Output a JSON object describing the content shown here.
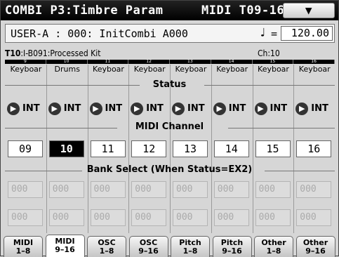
{
  "title": {
    "mode": "COMBI",
    "page": "P3:Timbre Param",
    "subpage": "MIDI T09-16",
    "menu_symbol": "▼"
  },
  "program": {
    "name": "USER-A : 000: InitCombi  A000",
    "tempo_symbol": "♩",
    "tempo_eq": "=",
    "tempo": "120.00"
  },
  "info": {
    "timbre_prefix": "T10",
    "timbre_name": ":I-B091:Processed Kit",
    "channel": "Ch:10"
  },
  "columns": [
    "9",
    "10",
    "11",
    "12",
    "13",
    "14",
    "15",
    "16"
  ],
  "types": [
    "Keyboar",
    "Drums",
    "Keyboar",
    "Keyboar",
    "Keyboar",
    "Keyboar",
    "Keyboar",
    "Keyboar"
  ],
  "labels": {
    "status": "Status",
    "midi_channel": "MIDI Channel",
    "bank_select": "Bank Select (When Status=EX2)"
  },
  "status": [
    "INT",
    "INT",
    "INT",
    "INT",
    "INT",
    "INT",
    "INT",
    "INT"
  ],
  "channels": [
    "09",
    "10",
    "11",
    "12",
    "13",
    "14",
    "15",
    "16"
  ],
  "bank_msb": [
    "000",
    "000",
    "000",
    "000",
    "000",
    "000",
    "000",
    "000"
  ],
  "bank_lsb": [
    "000",
    "000",
    "000",
    "000",
    "000",
    "000",
    "000",
    "000"
  ],
  "tabs": [
    {
      "l1": "MIDI",
      "l2": "1–8"
    },
    {
      "l1": "MIDI",
      "l2": "9–16"
    },
    {
      "l1": "OSC",
      "l2": "1–8"
    },
    {
      "l1": "OSC",
      "l2": "9–16"
    },
    {
      "l1": "Pitch",
      "l2": "1–8"
    },
    {
      "l1": "Pitch",
      "l2": "9–16"
    },
    {
      "l1": "Other",
      "l2": "1–8"
    },
    {
      "l1": "Other",
      "l2": "9–16"
    }
  ]
}
